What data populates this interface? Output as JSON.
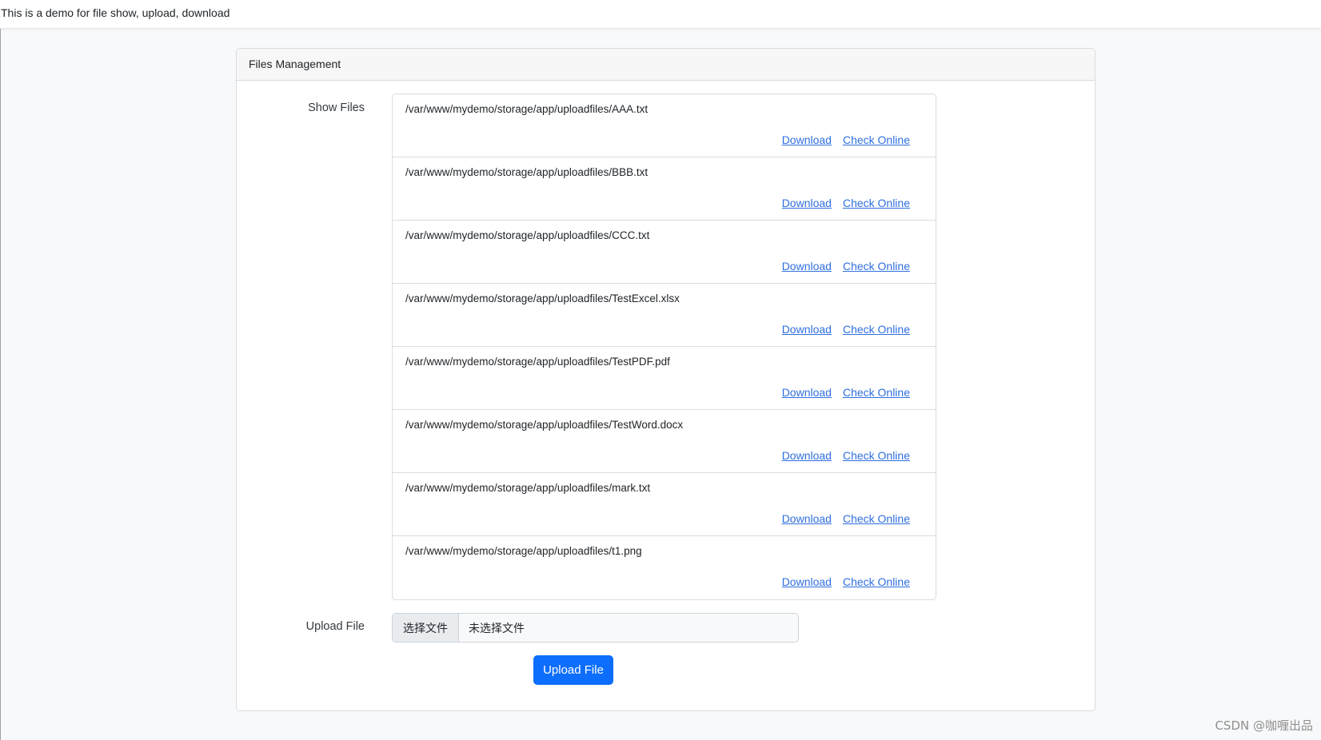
{
  "header": {
    "text": "This is a demo for file show, upload, download"
  },
  "card": {
    "title": "Files Management",
    "show_files_label": "Show Files",
    "upload_label": "Upload File"
  },
  "files": [
    {
      "path": "/var/www/mydemo/storage/app/uploadfiles/AAA.txt",
      "download": "Download",
      "check": "Check Online"
    },
    {
      "path": "/var/www/mydemo/storage/app/uploadfiles/BBB.txt",
      "download": "Download",
      "check": "Check Online"
    },
    {
      "path": "/var/www/mydemo/storage/app/uploadfiles/CCC.txt",
      "download": "Download",
      "check": "Check Online"
    },
    {
      "path": "/var/www/mydemo/storage/app/uploadfiles/TestExcel.xlsx",
      "download": "Download",
      "check": "Check Online"
    },
    {
      "path": "/var/www/mydemo/storage/app/uploadfiles/TestPDF.pdf",
      "download": "Download",
      "check": "Check Online"
    },
    {
      "path": "/var/www/mydemo/storage/app/uploadfiles/TestWord.docx",
      "download": "Download",
      "check": "Check Online"
    },
    {
      "path": "/var/www/mydemo/storage/app/uploadfiles/mark.txt",
      "download": "Download",
      "check": "Check Online"
    },
    {
      "path": "/var/www/mydemo/storage/app/uploadfiles/t1.png",
      "download": "Download",
      "check": "Check Online"
    }
  ],
  "upload": {
    "choose_label": "选择文件",
    "no_file_label": "未选择文件",
    "submit_label": "Upload File"
  },
  "watermark": "CSDN @咖喱出品",
  "colors": {
    "link": "#2f6fe0",
    "primary": "#0d6efd"
  }
}
